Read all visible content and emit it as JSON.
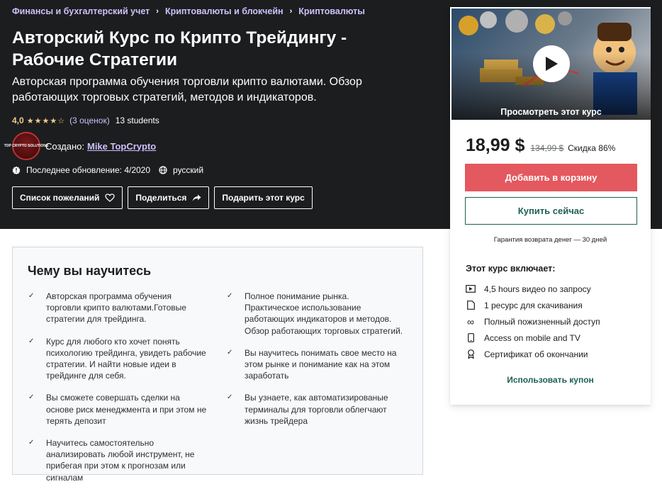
{
  "breadcrumb": [
    "Финансы и бухгалтерский учет",
    "Криптовалюты и блокчейн",
    "Криптовалюты"
  ],
  "course": {
    "title": "Авторский Курс по Крипто Трейдингу - Рабочие Стратегии",
    "subtitle": "Авторская программа обучения торговли крипто валютами. Обзор работающих торговых стратегий, методов и индикаторов.",
    "rating": "4,0",
    "stars": 4,
    "ratings_count": "(3 оценок)",
    "students": "13 students",
    "creator_label": "Создано:",
    "creator_name": "Mike TopCrypto",
    "avatar_text": "TOP CRYPTO SOLUTIONS",
    "last_updated": "Последнее обновление: 4/2020",
    "language": "русский"
  },
  "actions": {
    "wishlist": "Список пожеланий",
    "share": "Поделиться",
    "gift": "Подарить этот курс"
  },
  "learn": {
    "title": "Чему вы научитесь",
    "left": [
      "Авторская программа обучения торговли крипто валютами.Готовые стратегии для трейдинга.",
      "Курс для любого кто хочет понять психологию трейдинга, увидеть рабочие стратегии. И найти новые идеи в трейдинге для себя.",
      "Вы сможете совершать сделки на основе риск менеджмента и при этом не терять депозит",
      "Научитесь самостоятельно анализировать любой инструмент, не прибегая при этом к прогнозам или сигналам"
    ],
    "right": [
      "Полное понимание рынка. Практическое использование работающих индикаторов и методов. Обзор работающих торговых стратегий.",
      "Вы научитесь понимать свое место на этом рынке и понимание как на этом заработать",
      "Вы узнаете, как автоматизированые терминалы для торговли облегчают жизнь трейдера"
    ]
  },
  "card": {
    "preview_label": "Просмотреть этот курс",
    "price": "18,99 $",
    "old_price": "134,99 $",
    "discount": "Скидка 86%",
    "add_to_cart": "Добавить в корзину",
    "buy_now": "Купить сейчас",
    "guarantee": "Гарантия возврата денег — 30 дней",
    "includes_title": "Этот курс включает:",
    "includes": [
      {
        "icon": "video-icon",
        "text": "4,5 hours видео по запросу"
      },
      {
        "icon": "file-icon",
        "text": "1 ресурс для скачивания"
      },
      {
        "icon": "infinity-icon",
        "text": "Полный пожизненный доступ"
      },
      {
        "icon": "mobile-icon",
        "text": "Access on mobile and TV"
      },
      {
        "icon": "certificate-icon",
        "text": "Сертификат об окончании"
      }
    ],
    "coupon": "Использовать купон"
  },
  "colors": {
    "hero_bg": "#1c1d1f",
    "accent_purple": "#cec0fc",
    "star": "#f3ca8c",
    "cart": "#e4585f",
    "teal": "#1e6055"
  }
}
